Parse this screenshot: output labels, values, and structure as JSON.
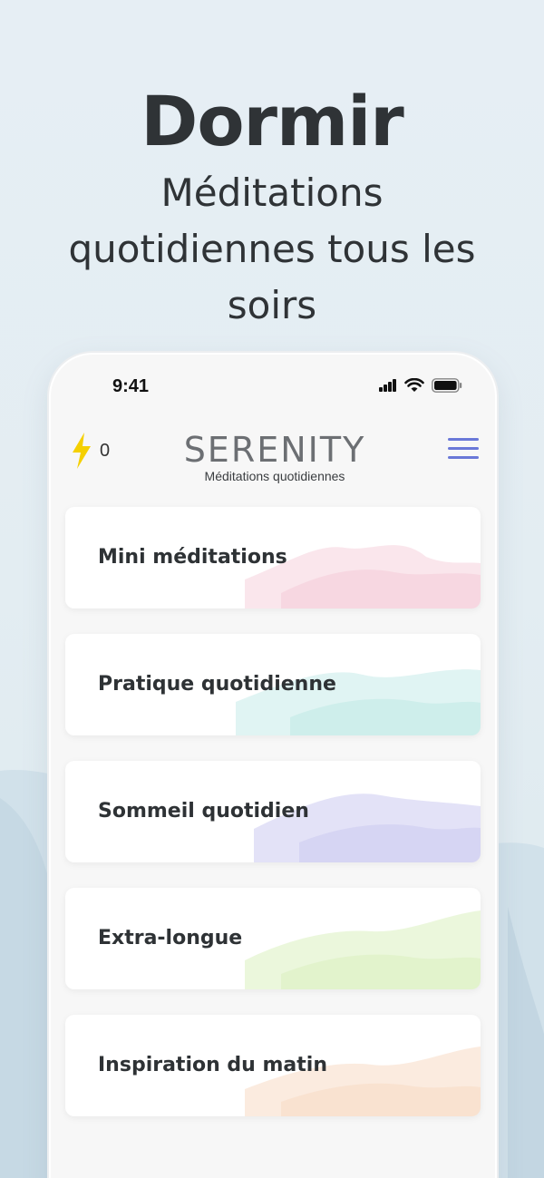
{
  "hero": {
    "title": "Dormir",
    "subtitle": "Méditations quotidiennes tous les soirs"
  },
  "status_bar": {
    "time": "9:41",
    "icons": [
      "signal-icon",
      "wifi-icon",
      "battery-icon"
    ]
  },
  "header": {
    "energy_icon": "lightning-icon",
    "energy_count": "0",
    "brand_name": "SERENITY",
    "brand_tagline": "Méditations quotidiennes",
    "menu_icon": "hamburger-menu-icon"
  },
  "categories": [
    {
      "label": "Mini méditations",
      "accent": "#f2b6c8"
    },
    {
      "label": "Pratique quotidienne",
      "accent": "#a6e0dc"
    },
    {
      "label": "Sommeil quotidien",
      "accent": "#b9b6ec"
    },
    {
      "label": "Extra-longue",
      "accent": "#cdeaa8"
    },
    {
      "label": "Inspiration du matin",
      "accent": "#f6cdb0"
    }
  ],
  "colors": {
    "background": "#e3edf2",
    "menu_accent": "#6a78d8",
    "energy_accent": "#f5d000",
    "mountains": "#c9dbe5"
  }
}
